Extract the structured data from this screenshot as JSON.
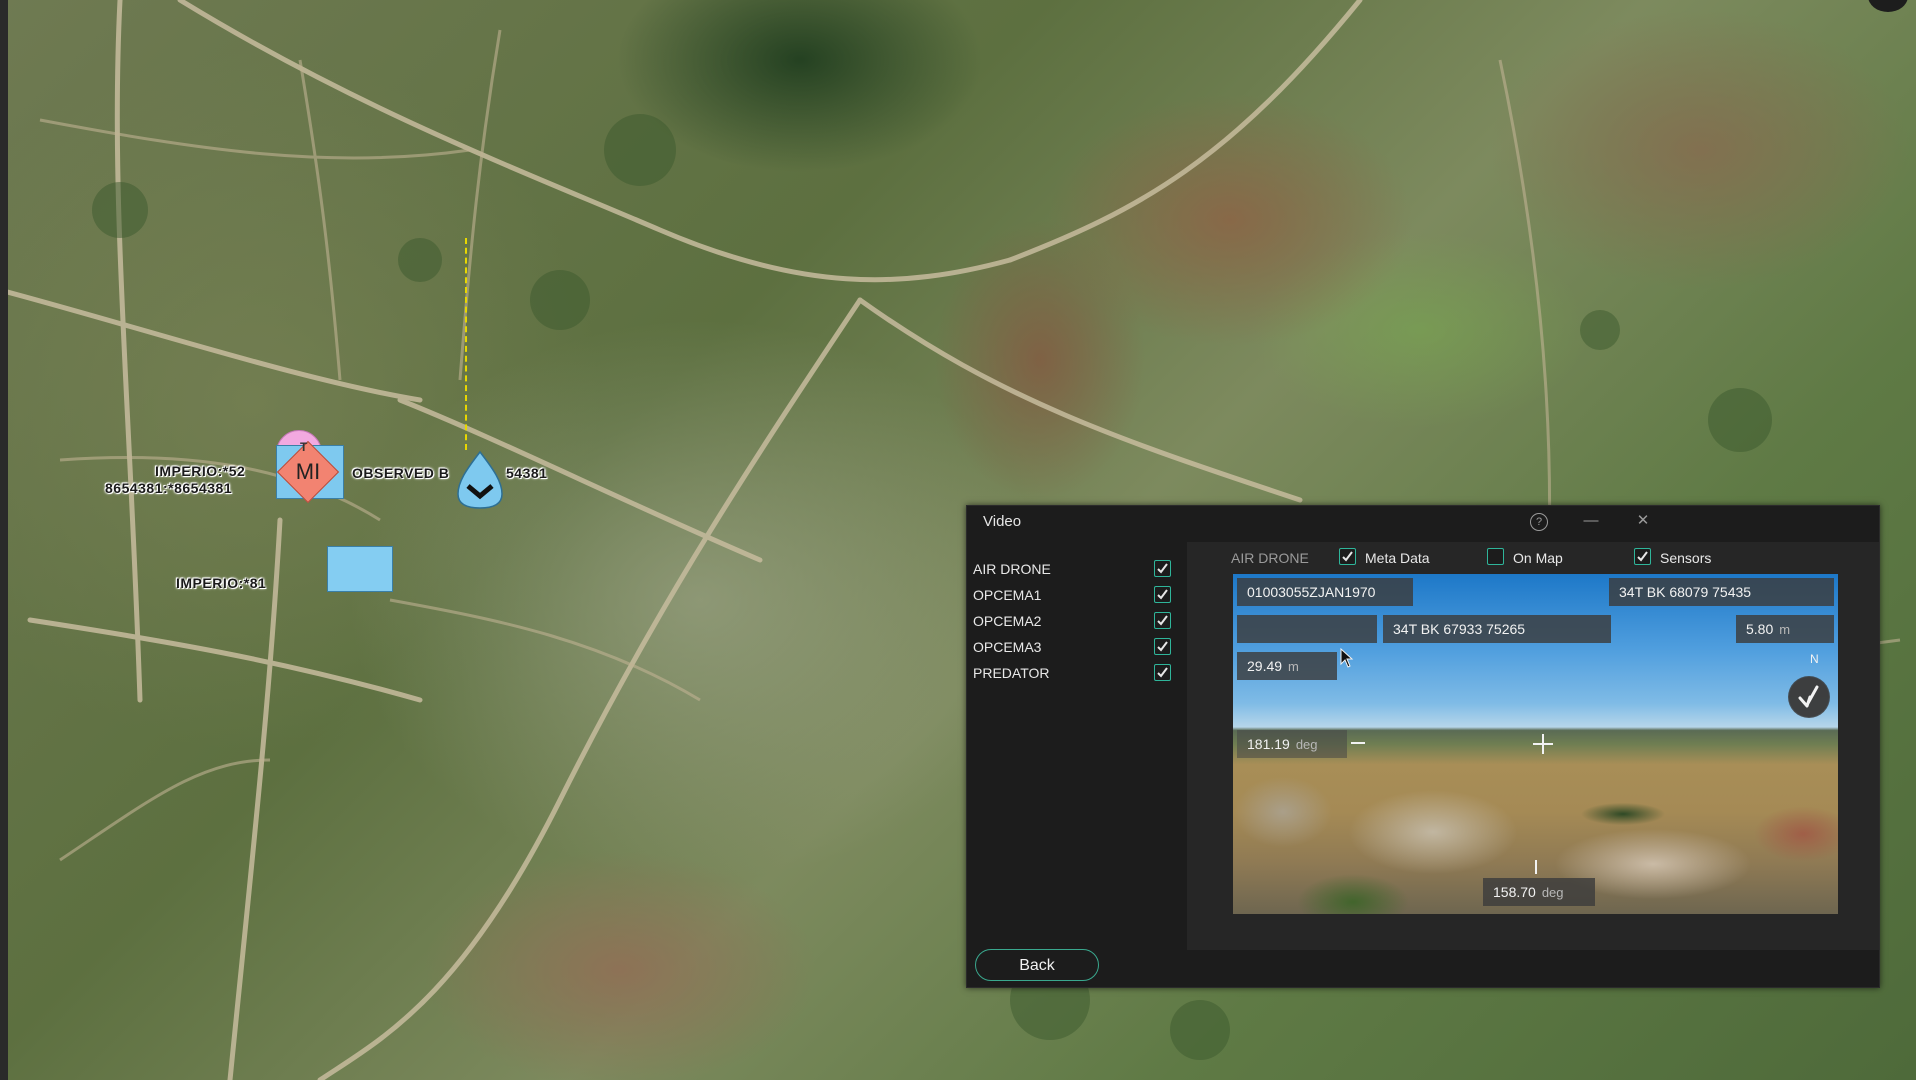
{
  "map": {
    "markers": [
      {
        "label_line1": "IMPERIO:*52",
        "label_line2": "8654381:*8654381",
        "symbol_text": "MI",
        "symbol_top": "T"
      },
      {
        "label": "OBSERVED B",
        "label_suffix": "54381"
      },
      {
        "label": "IMPERIO:*81"
      }
    ]
  },
  "video_window": {
    "title": "Video",
    "help_glyph": "?",
    "minimize_glyph": "—",
    "close_glyph": "✕",
    "assets": [
      {
        "name": "AIR DRONE",
        "checked": true
      },
      {
        "name": "OPCEMA1",
        "checked": true
      },
      {
        "name": "OPCEMA2",
        "checked": true
      },
      {
        "name": "OPCEMA3",
        "checked": true
      },
      {
        "name": "PREDATOR",
        "checked": true
      }
    ],
    "selected_source": "AIR DRONE",
    "options": [
      {
        "label": "Meta Data",
        "checked": true
      },
      {
        "label": "On Map",
        "checked": false
      },
      {
        "label": "Sensors",
        "checked": true
      }
    ],
    "overlay": {
      "timestamp": "01003055ZJAN1970",
      "coord_target": "34T BK 68079 75435",
      "coord_sensor": "34T BK 67933 75265",
      "altitude_right": "5.80",
      "altitude_right_unit": "m",
      "altitude_left": "29.49",
      "altitude_left_unit": "m",
      "north_label": "N",
      "heading_left": "181.19",
      "heading_left_unit": "deg",
      "heading_bottom": "158.70",
      "heading_bottom_unit": "deg"
    },
    "back_label": "Back",
    "colors": {
      "accent": "#2fb59a",
      "panel": "#1c1c1c"
    }
  }
}
